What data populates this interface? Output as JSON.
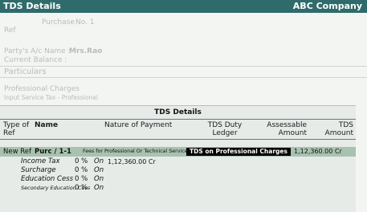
{
  "header": {
    "title": "TDS Details",
    "company": "ABC Company"
  },
  "voucher": {
    "type_label": "Purchase",
    "no_label": "No. 1",
    "ref_label": "Ref",
    "party_label": "Party's A/c Name :",
    "party_value": "Mrs.Rao",
    "balance_label": "Current Balance :",
    "particulars_label": "Particulars",
    "item1": "Professional Charges",
    "item2": "Input Service Tax - Professional"
  },
  "tds": {
    "title": "TDS Details",
    "columns": {
      "type_of_ref": "Type of",
      "ref": "Ref",
      "name": "Name",
      "nature": "Nature of Payment",
      "duty_ledger_1": "TDS Duty",
      "duty_ledger_2": "Ledger",
      "assessable_1": "Assessable",
      "assessable_2": "Amount",
      "tds_1": "TDS",
      "tds_2": "Amount"
    },
    "row": {
      "type": "New Ref",
      "name": "Purc / 1-1",
      "nature": "Fees for Professional Or Technical Services",
      "ledger": "TDS on Professional Charges",
      "assessable": "1,12,360.00 Cr"
    },
    "breakup": [
      {
        "label": "Income Tax",
        "pct": "0 %",
        "on": "On",
        "amount": "1,12,360.00 Cr"
      },
      {
        "label": "Surcharge",
        "pct": "0 %",
        "on": "On",
        "amount": ""
      },
      {
        "label": "Education Cess",
        "pct": "0 %",
        "on": "On",
        "amount": ""
      },
      {
        "label": "Secondary Education Cess",
        "pct": "0 %",
        "on": "On",
        "amount": ""
      }
    ]
  }
}
